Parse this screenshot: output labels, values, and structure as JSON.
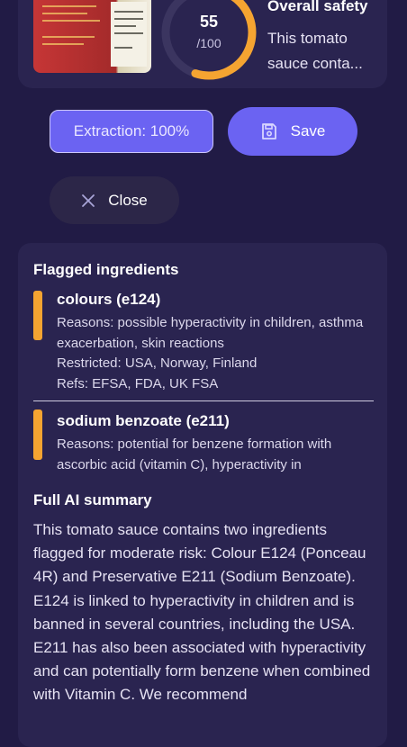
{
  "score": {
    "value": "55",
    "max": "/100",
    "fraction": 0.55,
    "title": "Overall safety",
    "summary_preview": "This tomato sauce conta..."
  },
  "actions": {
    "extraction_label": "Extraction: 100%",
    "save_label": "Save",
    "close_label": "Close"
  },
  "flagged": {
    "title": "Flagged ingredients",
    "items": [
      {
        "name": "colours (e124)",
        "reasons": "Reasons: possible hyperactivity in children, asthma exacerbation, skin reactions",
        "restricted": "Restricted: USA, Norway, Finland",
        "refs": "Refs: EFSA, FDA, UK FSA"
      },
      {
        "name": "sodium benzoate (e211)",
        "reasons": "Reasons: potential for benzene formation with ascorbic acid (vitamin C), hyperactivity in"
      }
    ]
  },
  "summary": {
    "title": "Full AI summary",
    "text": "This tomato sauce contains two ingredients flagged for moderate risk: Colour E124 (Ponceau 4R) and Preservative E211 (Sodium Benzoate). E124 is linked to hyperactivity in children and is banned in several countries, including the USA. E211 has also been associated with hyperactivity and can potentially form benzene when combined with Vitamin C. We recommend"
  },
  "colors": {
    "accent": "#6b63f2",
    "warning": "#f5a431",
    "background": "#211b45",
    "card": "#2a2450"
  }
}
